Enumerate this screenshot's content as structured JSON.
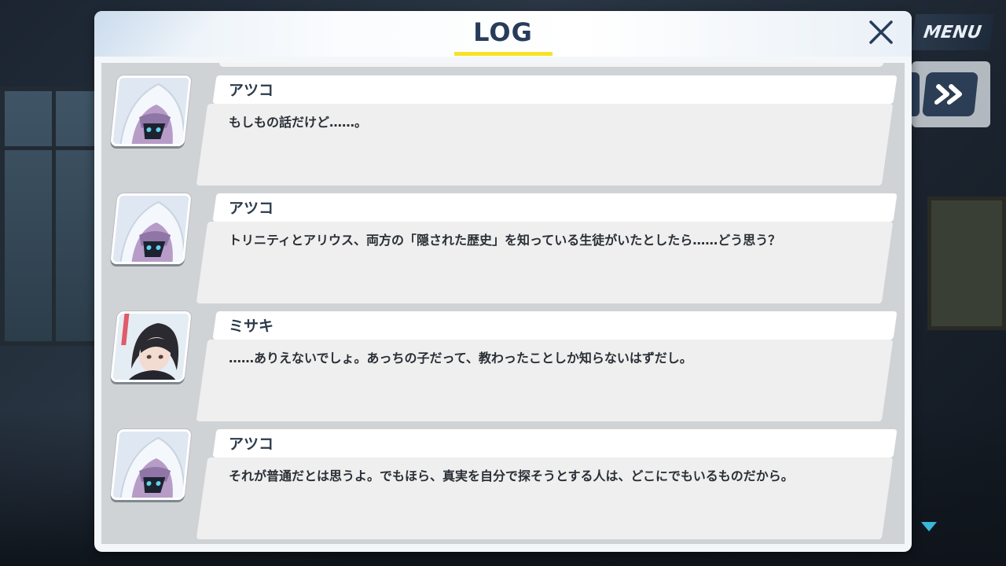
{
  "window": {
    "title": "LOG"
  },
  "menu": {
    "label": "MENU",
    "skip_icon": "fast-forward-icon"
  },
  "controls": {
    "close_icon": "close-icon",
    "scroll_icon": "scroll-down-icon"
  },
  "colors": {
    "title": "#283c5a",
    "underline": "#f7e22a",
    "name": "#2c3a4c",
    "message": "#2a2f36",
    "menu_bg": "#2c3d56",
    "scroll_indicator": "#39b7d8"
  },
  "entries": [
    {
      "speaker": "アツコ",
      "portrait": "atsuko-portrait",
      "text": "もしもの話だけど……。"
    },
    {
      "speaker": "アツコ",
      "portrait": "atsuko-portrait",
      "text": "トリニティとアリウス、両方の「隠された歴史」を知っている生徒がいたとしたら……どう思う？"
    },
    {
      "speaker": "ミサキ",
      "portrait": "misaki-portrait",
      "text": "……ありえないでしょ。あっちの子だって、教わったことしか知らないはずだし。"
    },
    {
      "speaker": "アツコ",
      "portrait": "atsuko-portrait",
      "text": "それが普通だとは思うよ。でもほら、真実を自分で探そうとする人は、どこにでもいるものだから。"
    }
  ]
}
